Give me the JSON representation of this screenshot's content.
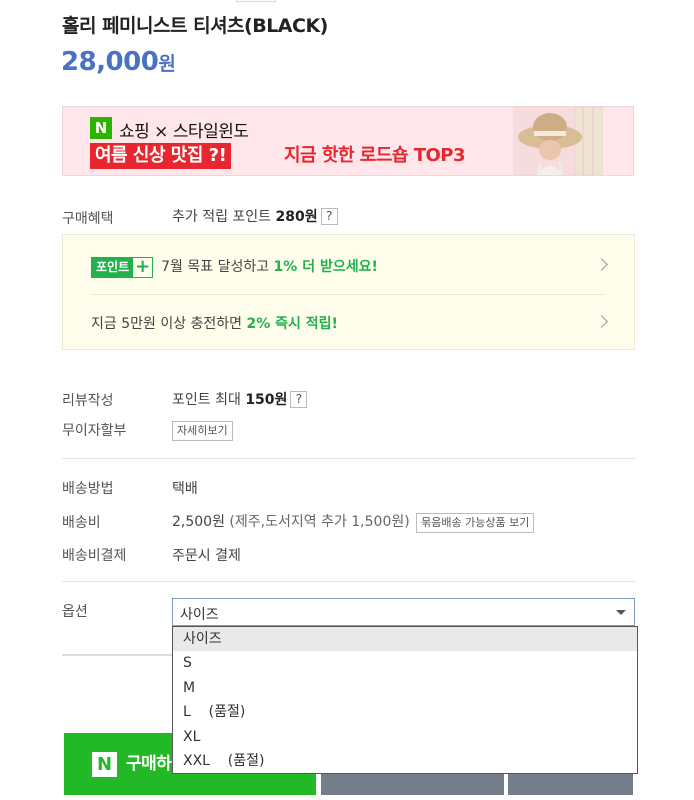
{
  "product": {
    "title": "홀리 페미니스트 티셔츠(BLACK)",
    "price": "28,000",
    "currency": "원"
  },
  "banner": {
    "logo": "N",
    "line1": "쇼핑 × 스타일윈도",
    "highlight": "여름 신상 맛집 ?!",
    "line2": "지금 핫한 로드숍 TOP3"
  },
  "benefits": {
    "label": "구매혜택",
    "points_text": "추가 적립 포인트",
    "points_value": "280원",
    "help": "?",
    "point_badge": "포인트",
    "point_badge_plus": "+",
    "row1_text": "7월 목표 달성하고",
    "row1_emph": "1% 더 받으세요!",
    "row2_text": "지금 5만원 이상 충전하면",
    "row2_emph": "2% 즉시 적립!"
  },
  "review": {
    "label": "리뷰작성",
    "text": "포인트 최대",
    "value": "150원",
    "help": "?"
  },
  "installment": {
    "label": "무이자할부",
    "button": "자세히보기"
  },
  "shipping": {
    "method_label": "배송방법",
    "method_value": "택배",
    "fee_label": "배송비",
    "fee_value": "2,500원",
    "fee_extra": "(제주,도서지역 추가 1,500원)",
    "bundle_button": "묶음배송 가능상품 보기",
    "payment_label": "배송비결제",
    "payment_value": "주문시 결제"
  },
  "option": {
    "label": "옵션",
    "selected": "사이즈",
    "items": [
      "사이즈",
      "S",
      "M",
      "L    (품절)",
      "XL",
      "XXL    (품절)"
    ]
  },
  "buttons": {
    "buy_logo": "N",
    "buy_label": "구매하기"
  },
  "colors": {
    "price": "#4a71c2",
    "naver_green": "#22b826",
    "point_green": "#22b14c",
    "banner_bg": "#ffe6ea",
    "banner_red": "#e8262f",
    "benefit_bg": "#fffdeb",
    "gray_button": "#747d8a"
  }
}
